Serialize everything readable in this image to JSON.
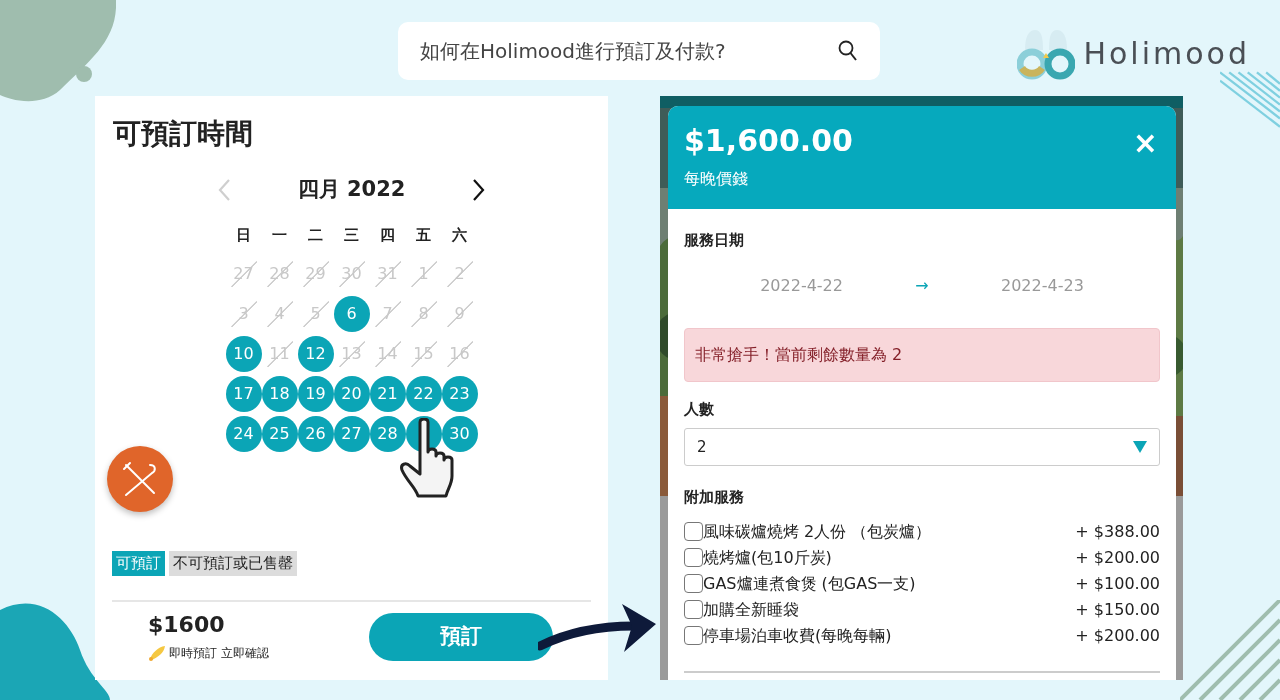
{
  "search": {
    "query": "如何在Holimood進行預訂及付款?"
  },
  "brand": {
    "name": "Holimood"
  },
  "booking_panel": {
    "title": "可預訂時間",
    "calendar": {
      "month": "四月  2022",
      "prev": {
        "disabled": true
      },
      "next": {
        "disabled": false
      },
      "weekdays": [
        "日",
        "一",
        "二",
        "三",
        "四",
        "五",
        "六"
      ],
      "days": [
        {
          "label": "27",
          "available": false
        },
        {
          "label": "28",
          "available": false
        },
        {
          "label": "29",
          "available": false
        },
        {
          "label": "30",
          "available": false
        },
        {
          "label": "31",
          "available": false
        },
        {
          "label": "1",
          "available": false
        },
        {
          "label": "2",
          "available": false
        },
        {
          "label": "3",
          "available": false
        },
        {
          "label": "4",
          "available": false
        },
        {
          "label": "5",
          "available": false
        },
        {
          "label": "6",
          "available": true
        },
        {
          "label": "7",
          "available": false
        },
        {
          "label": "8",
          "available": false
        },
        {
          "label": "9",
          "available": false
        },
        {
          "label": "10",
          "available": true
        },
        {
          "label": "11",
          "available": false
        },
        {
          "label": "12",
          "available": true
        },
        {
          "label": "13",
          "available": false
        },
        {
          "label": "14",
          "available": false
        },
        {
          "label": "15",
          "available": false
        },
        {
          "label": "16",
          "available": false
        },
        {
          "label": "17",
          "available": true
        },
        {
          "label": "18",
          "available": true
        },
        {
          "label": "19",
          "available": true
        },
        {
          "label": "20",
          "available": true
        },
        {
          "label": "21",
          "available": true
        },
        {
          "label": "22",
          "available": true
        },
        {
          "label": "23",
          "available": true
        },
        {
          "label": "24",
          "available": true
        },
        {
          "label": "25",
          "available": true
        },
        {
          "label": "26",
          "available": true
        },
        {
          "label": "27",
          "available": true
        },
        {
          "label": "28",
          "available": true
        },
        {
          "available": true
        },
        {
          "label": "30",
          "available": true
        }
      ]
    },
    "legend": [
      {
        "label": "可預訂",
        "available": true
      },
      {
        "label": "不可預訂或已售罄",
        "available": false
      }
    ],
    "price": "$1600",
    "instant_note": "即時預訂 立即確認",
    "book_button": "預訂"
  },
  "booking_modal": {
    "price": "$1,600.00",
    "price_caption": "每晚價錢",
    "close": "×",
    "service_date_label": "服務日期",
    "start_date": "2022-4-22",
    "date_arrow": "→",
    "end_date": "2022-4-23",
    "alert": "非常搶手！當前剩餘數量為 2",
    "guests_label": "人數",
    "guests_value": "2",
    "addons_label": "附加服務",
    "addons": [
      {
        "label": "風味碳爐燒烤 2人份 （包炭爐）",
        "price": "+ $388.00",
        "checked": false
      },
      {
        "label": "燒烤爐(包10斤炭)",
        "price": "+ $200.00",
        "checked": false
      },
      {
        "label": "GAS爐連煮食煲 (包GAS一支)",
        "price": "+ $100.00",
        "checked": false
      },
      {
        "label": "加購全新睡袋",
        "price": "+ $150.00",
        "checked": false
      },
      {
        "label": "停車場泊車收費(每晚每輛)",
        "price": "+ $200.00",
        "checked": false
      }
    ]
  }
}
